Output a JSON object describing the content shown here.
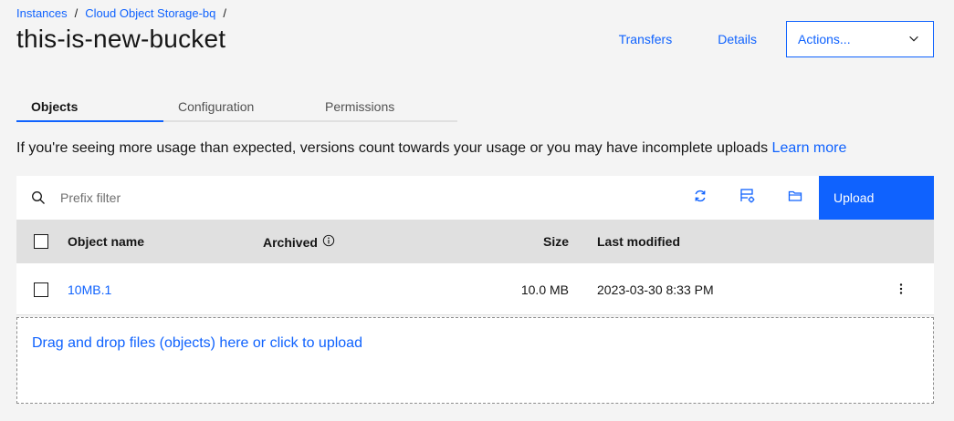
{
  "breadcrumb": {
    "items": [
      "Instances",
      "Cloud Object Storage-bq"
    ],
    "separator": "/"
  },
  "page": {
    "title": "this-is-new-bucket"
  },
  "header": {
    "transfers_label": "Transfers",
    "details_label": "Details",
    "actions_label": "Actions..."
  },
  "tabs": [
    {
      "label": "Objects",
      "active": true
    },
    {
      "label": "Configuration",
      "active": false
    },
    {
      "label": "Permissions",
      "active": false
    }
  ],
  "notice": {
    "text": "If you're seeing more usage than expected, versions count towards your usage or you may have incomplete uploads",
    "link": "Learn more"
  },
  "toolbar": {
    "search_placeholder": "Prefix filter",
    "icons": [
      "refresh-icon",
      "settings-view-icon",
      "folder-icon"
    ],
    "upload_label": "Upload"
  },
  "table": {
    "columns": {
      "name": "Object name",
      "archived": "Archived",
      "size": "Size",
      "modified": "Last modified"
    },
    "rows": [
      {
        "name": "10MB.1",
        "archived": "",
        "size": "10.0 MB",
        "modified": "2023-03-30 8:33 PM"
      }
    ]
  },
  "dropzone": {
    "text": "Drag and drop files (objects) here or click to upload"
  },
  "colors": {
    "accent": "#0f62fe",
    "background": "#f4f4f4",
    "header_bg": "#e0e0e0"
  }
}
